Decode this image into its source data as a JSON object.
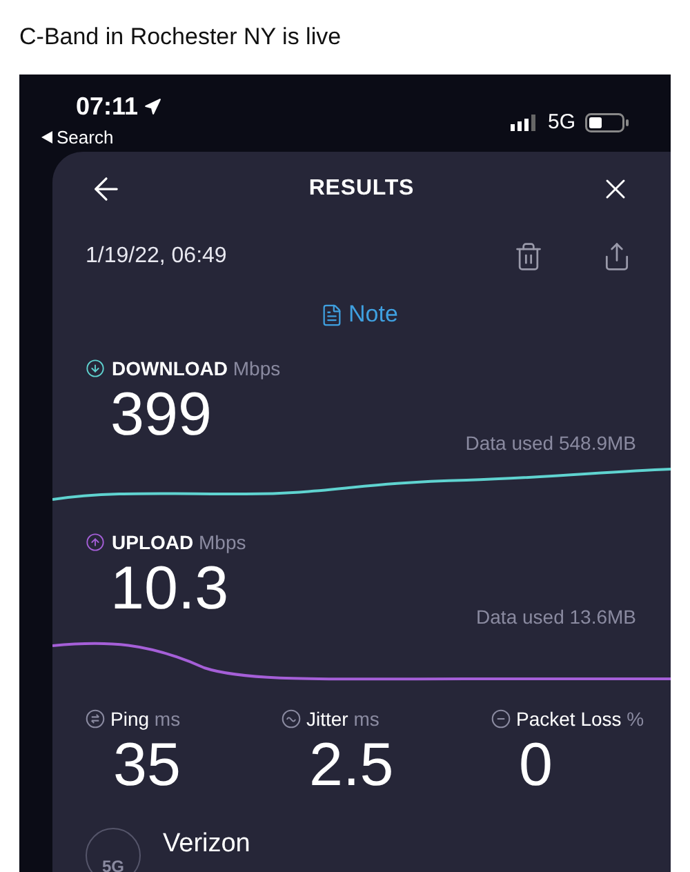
{
  "post": {
    "title": "C-Band in Rochester NY is live"
  },
  "status_bar": {
    "time": "07:11",
    "back_label": "Search",
    "network": "5G"
  },
  "header": {
    "title": "RESULTS"
  },
  "result": {
    "timestamp": "1/19/22, 06:49",
    "note_label": "Note"
  },
  "speeds": [
    {
      "kind": "download",
      "label": "DOWNLOAD",
      "unit": "Mbps",
      "value": "399",
      "data_used": "Data used 548.9MB",
      "color": "#5fd3d0"
    },
    {
      "kind": "upload",
      "label": "UPLOAD",
      "unit": "Mbps",
      "value": "10.3",
      "data_used": "Data used 13.6MB",
      "color": "#a55fd8"
    }
  ],
  "metrics": [
    {
      "label": "Ping",
      "unit": "ms",
      "value": "35"
    },
    {
      "label": "Jitter",
      "unit": "ms",
      "value": "2.5"
    },
    {
      "label": "Packet Loss",
      "unit": "%",
      "value": "0"
    }
  ],
  "provider": {
    "badge": "5G",
    "name": "Verizon"
  }
}
